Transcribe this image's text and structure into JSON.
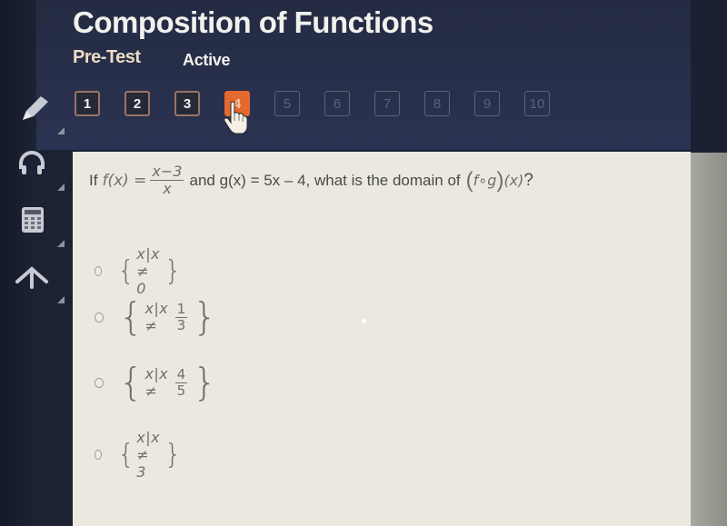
{
  "header": {
    "title": "Composition of Functions",
    "type": "Pre-Test",
    "status": "Active"
  },
  "question_nav": {
    "buttons": [
      {
        "label": "1",
        "state": "answered"
      },
      {
        "label": "2",
        "state": "answered"
      },
      {
        "label": "3",
        "state": "answered"
      },
      {
        "label": "4",
        "state": "current"
      },
      {
        "label": "5",
        "state": "locked"
      },
      {
        "label": "6",
        "state": "locked"
      },
      {
        "label": "7",
        "state": "locked"
      },
      {
        "label": "8",
        "state": "locked"
      },
      {
        "label": "9",
        "state": "locked"
      },
      {
        "label": "10",
        "state": "locked"
      }
    ],
    "current_color": "#e4692f"
  },
  "toolbar": {
    "tools": [
      {
        "icon": "pencil-icon"
      },
      {
        "icon": "headphones-icon"
      },
      {
        "icon": "calculator-icon"
      },
      {
        "icon": "arrow-up-icon"
      }
    ]
  },
  "question": {
    "prefix": "If",
    "f_label": "f(x) =",
    "f_numerator": "x−3",
    "f_denominator": "x",
    "middle": "and g(x) = 5x – 4, what is the domain of",
    "composition": "f∘g",
    "arg": "(x)",
    "suffix": "?"
  },
  "options": [
    {
      "body": "x|x ≠ 0",
      "fraction": null
    },
    {
      "body": "x|x ≠",
      "fraction": {
        "num": "1",
        "den": "3"
      }
    },
    {
      "body": "x|x ≠",
      "fraction": {
        "num": "4",
        "den": "5"
      }
    },
    {
      "body": "x|x ≠ 3",
      "fraction": null
    }
  ]
}
